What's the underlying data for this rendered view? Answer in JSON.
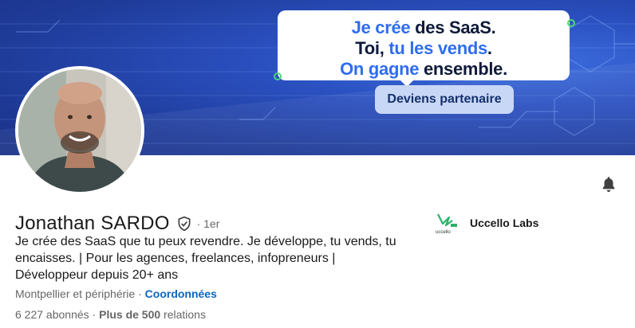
{
  "banner": {
    "line1_blue": "Je crée",
    "line1_dark": " des SaaS.",
    "line2_dark_a": "Toi, ",
    "line2_blue": "tu les vends",
    "line2_dark_b": ".",
    "line3_blue": "On gagne",
    "line3_dark": " ensemble.",
    "cta": "Deviens partenaire",
    "accent_blue": "#2f6df0",
    "bg_blue": "#2a4fbf"
  },
  "profile": {
    "name": "Jonathan SARDO",
    "degree": "· 1er",
    "headline": "Je crée des SaaS que tu peux revendre. Je développe, tu vends, tu encaisses. | Pour les agences, freelances, infopreneurs | Développeur depuis 20+ ans",
    "location": "Montpellier et périphérie",
    "location_sep": " · ",
    "contact_link": "Coordonnées",
    "followers_count": "6 227",
    "followers_label": " abonnés",
    "connections_sep": " · ",
    "connections_count": "Plus de 500",
    "connections_label": " relations"
  },
  "company": {
    "name": "Uccello Labs",
    "logo_text": "uccello"
  },
  "icons": {
    "bell": "bell-icon",
    "verified": "shield-check-icon"
  },
  "colors": {
    "link": "#0a66c2",
    "muted": "#666666",
    "text": "#191919"
  }
}
